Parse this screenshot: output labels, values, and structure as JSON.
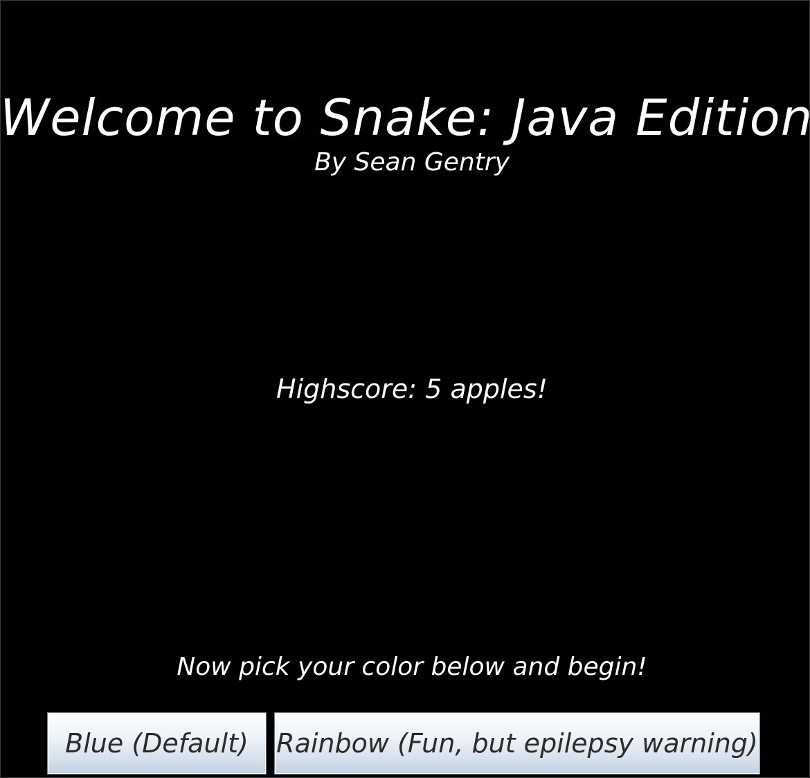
{
  "title": "Welcome to Snake: Java Edition",
  "subtitle": "By Sean Gentry",
  "highscore": "Highscore: 5 apples!",
  "prompt": "Now pick your color below and begin!",
  "buttons": {
    "blue_label": "Blue (Default)",
    "rainbow_label": "Rainbow (Fun, but epilepsy warning)"
  },
  "colors": {
    "background": "#000000",
    "text": "#ffffff",
    "button_text": "#2b2b2b"
  }
}
